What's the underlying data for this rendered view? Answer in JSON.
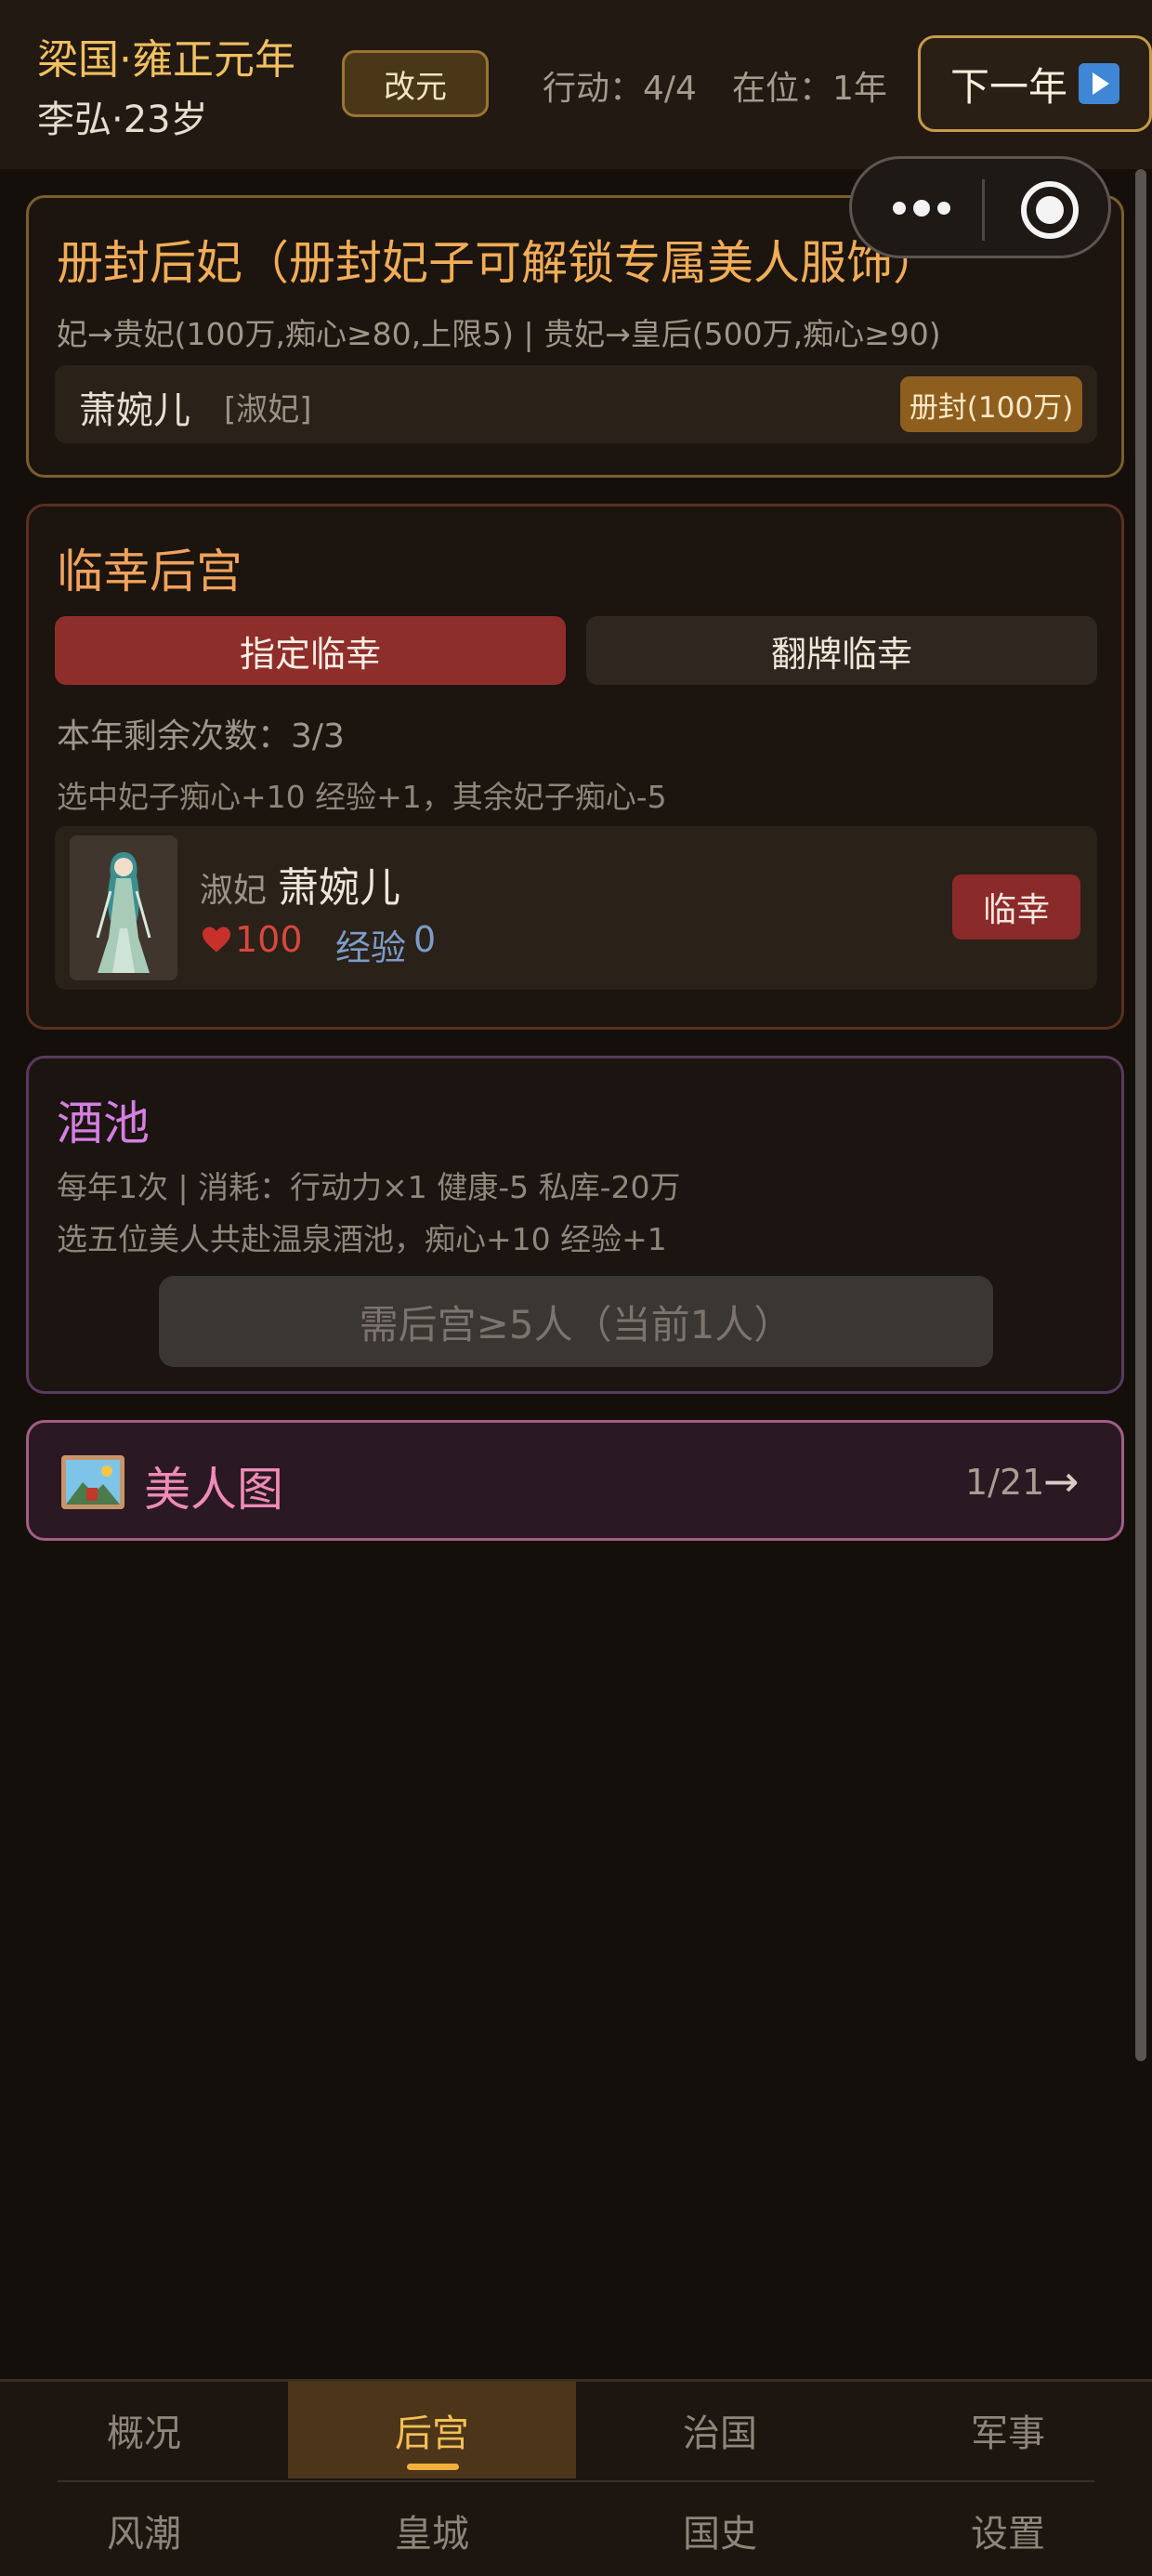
{
  "header": {
    "era_title": "梁国·雍正元年",
    "ruler": "李弘·23岁",
    "reform_label": "改元",
    "actions_label": "行动：4/4",
    "reign_label": "在位：1年",
    "next_year_label": "下一年"
  },
  "promote": {
    "title": "册封后妃（册封妃子可解锁专属美人服饰）",
    "rule": "妃→贵妃(100万,痴心≥80,上限5) | 贵妃→皇后(500万,痴心≥90)",
    "consort_name": "萧婉儿",
    "consort_rank": "[淑妃]",
    "button_label": "册封(100万)"
  },
  "favor": {
    "title": "临幸后宫",
    "tab_assign": "指定临幸",
    "tab_flip": "翻牌临幸",
    "remaining": "本年剩余次数：3/3",
    "rule": "选中妃子痴心+10 经验+1，其余妃子痴心-5",
    "consort": {
      "rank": "淑妃",
      "name": "萧婉儿",
      "affection": "100",
      "exp_label": "经验",
      "exp_value": "0"
    },
    "button_label": "临幸"
  },
  "pool": {
    "title": "酒池",
    "rule1": "每年1次 | 消耗：行动力×1 健康-5 私库-20万",
    "rule2": "选五位美人共赴温泉酒池，痴心+10 经验+1",
    "button_label": "需后宫≥5人（当前1人）"
  },
  "gallery": {
    "label": "美人图",
    "count": "1/21",
    "arrow": "→"
  },
  "nav": {
    "row1": [
      "概况",
      "后宫",
      "治国",
      "军事"
    ],
    "row2": [
      "风潮",
      "皇城",
      "国史",
      "设置"
    ],
    "active": "后宫"
  },
  "colors": {
    "gold": "#f1c060",
    "accent_red": "#8e2e2b",
    "pink": "#ee8bb6",
    "purple": "#d47fe2"
  }
}
